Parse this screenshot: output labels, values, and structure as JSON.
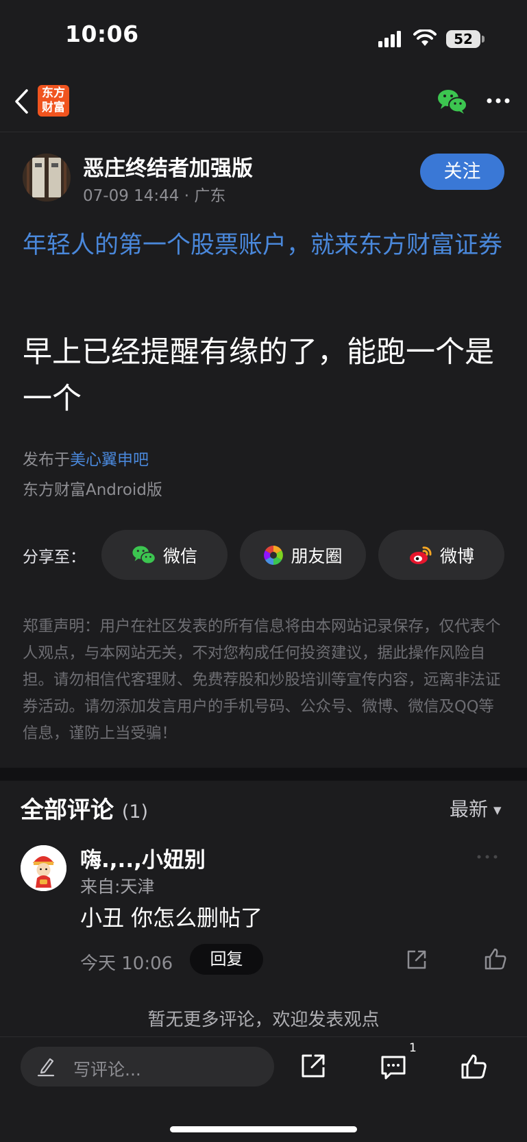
{
  "status_bar": {
    "time": "10:06",
    "battery": "52"
  },
  "nav": {
    "logo_text": "东方财富"
  },
  "post": {
    "author": "恶庄终结者加强版",
    "meta": "07-09 14:44 · 广东",
    "follow_label": "关注",
    "ad_link": "年轻人的第一个股票账户，就来东方财富证券",
    "body": "早上已经提醒有缘的了，能跑一个是一个",
    "published_prefix": "发布于",
    "published_bar": "美心翼申吧",
    "client": "东方财富Android版"
  },
  "share": {
    "label": "分享至：",
    "wechat": "微信",
    "moments": "朋友圈",
    "weibo": "微博"
  },
  "disclaimer": "郑重声明：用户在社区发表的所有信息将由本网站记录保存，仅代表个人观点，与本网站无关，不对您构成任何投资建议，据此操作风险自担。请勿相信代客理财、免费荐股和炒股培训等宣传内容，远离非法证券活动。请勿添加发言用户的手机号码、公众号、微博、微信及QQ等信息，谨防上当受骗！",
  "comments": {
    "title": "全部评论",
    "count": "(1)",
    "sort": "最新",
    "items": [
      {
        "name": "嗨.,..,小妞别",
        "location": "来自:天津",
        "text": "小丑 你怎么删帖了",
        "time": "今天 10:06",
        "reply_label": "回复"
      }
    ],
    "no_more": "暂无更多评论，欢迎发表观点"
  },
  "bottom": {
    "placeholder": "写评论...",
    "comment_badge": "1"
  }
}
